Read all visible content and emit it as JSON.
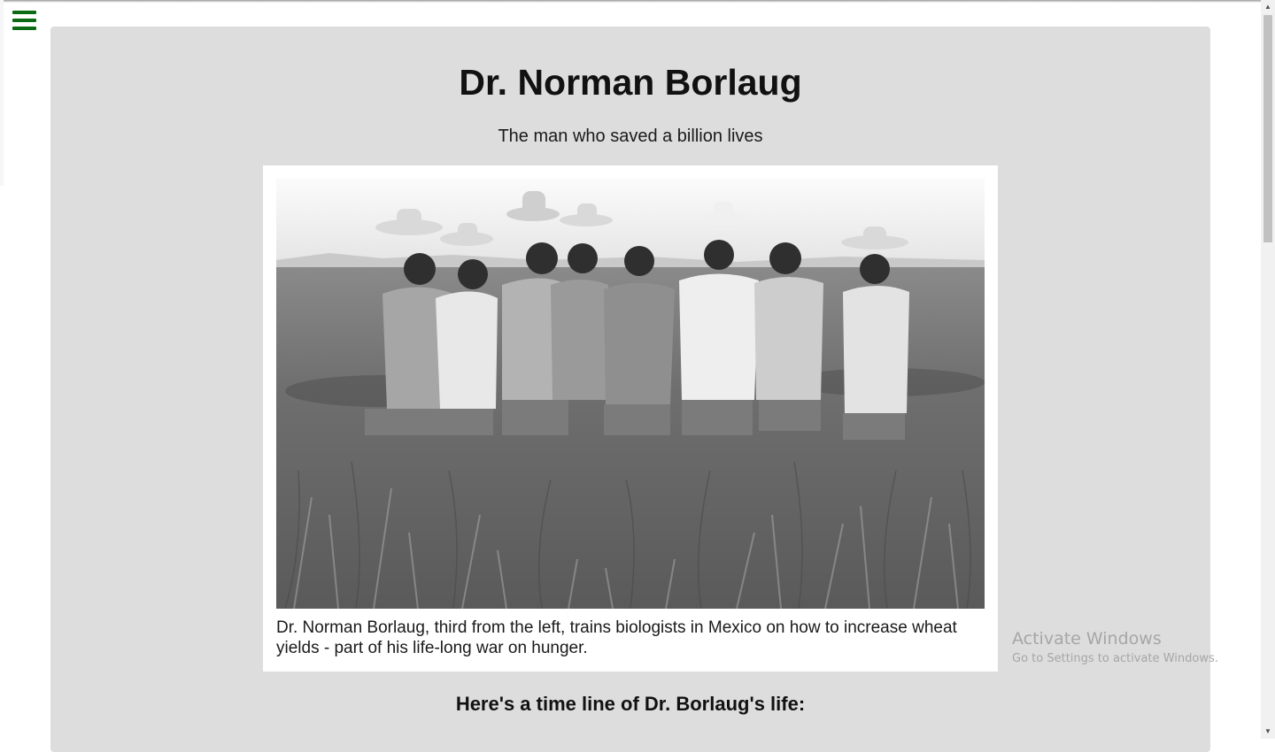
{
  "page": {
    "title": "Dr. Norman Borlaug",
    "subtitle": "The man who saved a billion lives"
  },
  "figure": {
    "caption": "Dr. Norman Borlaug, third from the left, trains biologists in Mexico on how to increase wheat yields - part of his life-long war on hunger."
  },
  "timeline": {
    "heading": "Here's a time line of Dr. Borlaug's life:"
  },
  "windows_watermark": {
    "line1": "Activate Windows",
    "line2": "Go to Settings to activate Windows."
  },
  "icons": {
    "menu": "hamburger-menu-icon",
    "scroll_up": "triangle-up-icon",
    "scroll_down": "triangle-down-icon"
  },
  "colors": {
    "menu_icon": "#0b6b12",
    "content_background": "#dddddd",
    "page_background": "#ffffff"
  }
}
